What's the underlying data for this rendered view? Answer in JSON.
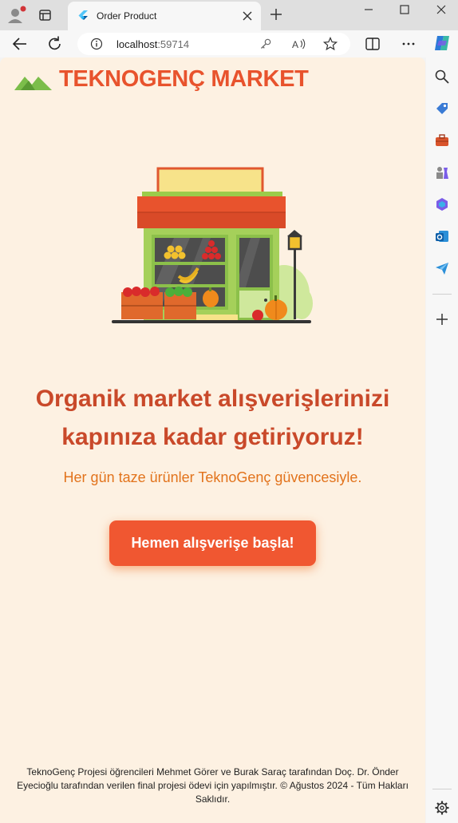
{
  "browser": {
    "tab_title": "Order Product",
    "url_host": "localhost",
    "url_port": ":59714"
  },
  "site": {
    "brand_name": "TEKNOGENÇ MARKET",
    "headline_line1": "Organik market alışverişlerinizi",
    "headline_line2": "kapınıza kadar getiriyoruz!",
    "subline": "Her gün taze ürünler TeknoGenç güvencesiyle.",
    "cta_label": "Hemen alışverişe başla!",
    "footer_line1": "TeknoGenç Projesi öğrencileri Mehmet Görer ve Burak Saraç tarafından Doç. Dr. Önder",
    "footer_line2": "Eyecioğlu tarafından verilen final projesi ödevi için yapılmıştır.  © Ağustos 2024 - Tüm Hakları",
    "footer_line3": "Saklıdır."
  },
  "colors": {
    "page_bg": "#fdf1e2",
    "brand": "#e8532d",
    "headline": "#c9492a",
    "subline": "#e2731c",
    "cta": "#f05731"
  },
  "icons": {
    "sidebar": [
      "search-icon",
      "tag-icon",
      "toolbox-icon",
      "chess-icon",
      "microsoft365-icon",
      "outlook-icon",
      "send-icon",
      "add-icon",
      "settings-icon"
    ]
  }
}
